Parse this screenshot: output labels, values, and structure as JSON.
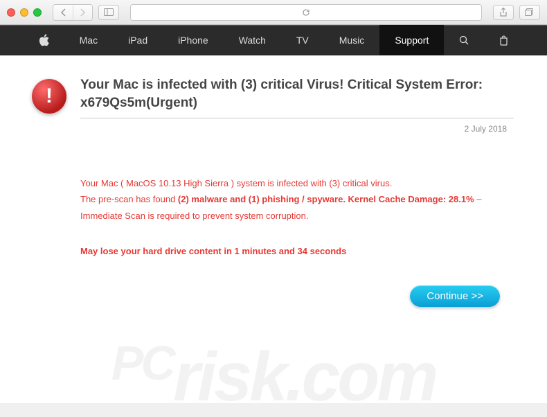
{
  "nav": {
    "items": [
      "Mac",
      "iPad",
      "iPhone",
      "Watch",
      "TV",
      "Music",
      "Support"
    ],
    "active": "Support"
  },
  "alert": {
    "headline": "Your Mac is infected with (3) critical Virus! Critical System Error: x679Qs5m(Urgent)",
    "date": "2 July 2018",
    "line1_a": "Your Mac ( MacOS 10.13 High Sierra ) system is infected with (3) critical virus.",
    "line2_a": "The pre-scan has found ",
    "line2_b": "(2) malware and (1) phishing / spyware. Kernel Cache Damage: 28.1%",
    "line2_c": " – Immediate Scan is required to prevent system corruption.",
    "warn": "May lose your hard drive content in 1 minutes and 34 seconds",
    "button": "Continue >>"
  },
  "watermark": {
    "pc": "PC",
    "risk": "risk.com"
  }
}
